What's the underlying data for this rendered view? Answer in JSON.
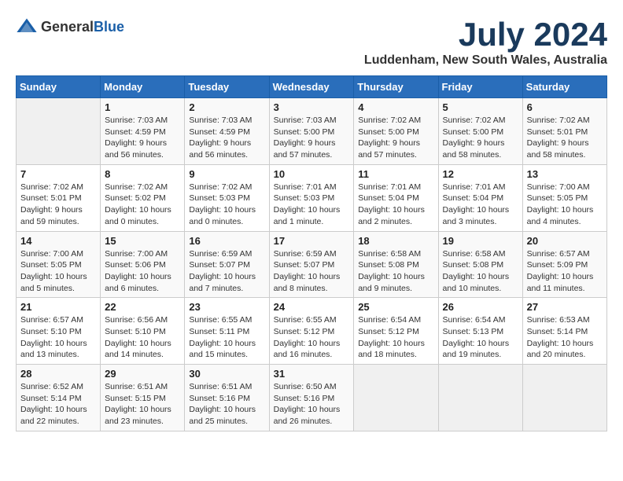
{
  "logo": {
    "general": "General",
    "blue": "Blue"
  },
  "title": {
    "month": "July 2024",
    "location": "Luddenham, New South Wales, Australia"
  },
  "days_of_week": [
    "Sunday",
    "Monday",
    "Tuesday",
    "Wednesday",
    "Thursday",
    "Friday",
    "Saturday"
  ],
  "weeks": [
    [
      {
        "day": "",
        "info": ""
      },
      {
        "day": "1",
        "info": "Sunrise: 7:03 AM\nSunset: 4:59 PM\nDaylight: 9 hours and 56 minutes."
      },
      {
        "day": "2",
        "info": "Sunrise: 7:03 AM\nSunset: 4:59 PM\nDaylight: 9 hours and 56 minutes."
      },
      {
        "day": "3",
        "info": "Sunrise: 7:03 AM\nSunset: 5:00 PM\nDaylight: 9 hours and 57 minutes."
      },
      {
        "day": "4",
        "info": "Sunrise: 7:02 AM\nSunset: 5:00 PM\nDaylight: 9 hours and 57 minutes."
      },
      {
        "day": "5",
        "info": "Sunrise: 7:02 AM\nSunset: 5:00 PM\nDaylight: 9 hours and 58 minutes."
      },
      {
        "day": "6",
        "info": "Sunrise: 7:02 AM\nSunset: 5:01 PM\nDaylight: 9 hours and 58 minutes."
      }
    ],
    [
      {
        "day": "7",
        "info": "Sunrise: 7:02 AM\nSunset: 5:01 PM\nDaylight: 9 hours and 59 minutes."
      },
      {
        "day": "8",
        "info": "Sunrise: 7:02 AM\nSunset: 5:02 PM\nDaylight: 10 hours and 0 minutes."
      },
      {
        "day": "9",
        "info": "Sunrise: 7:02 AM\nSunset: 5:03 PM\nDaylight: 10 hours and 0 minutes."
      },
      {
        "day": "10",
        "info": "Sunrise: 7:01 AM\nSunset: 5:03 PM\nDaylight: 10 hours and 1 minute."
      },
      {
        "day": "11",
        "info": "Sunrise: 7:01 AM\nSunset: 5:04 PM\nDaylight: 10 hours and 2 minutes."
      },
      {
        "day": "12",
        "info": "Sunrise: 7:01 AM\nSunset: 5:04 PM\nDaylight: 10 hours and 3 minutes."
      },
      {
        "day": "13",
        "info": "Sunrise: 7:00 AM\nSunset: 5:05 PM\nDaylight: 10 hours and 4 minutes."
      }
    ],
    [
      {
        "day": "14",
        "info": "Sunrise: 7:00 AM\nSunset: 5:05 PM\nDaylight: 10 hours and 5 minutes."
      },
      {
        "day": "15",
        "info": "Sunrise: 7:00 AM\nSunset: 5:06 PM\nDaylight: 10 hours and 6 minutes."
      },
      {
        "day": "16",
        "info": "Sunrise: 6:59 AM\nSunset: 5:07 PM\nDaylight: 10 hours and 7 minutes."
      },
      {
        "day": "17",
        "info": "Sunrise: 6:59 AM\nSunset: 5:07 PM\nDaylight: 10 hours and 8 minutes."
      },
      {
        "day": "18",
        "info": "Sunrise: 6:58 AM\nSunset: 5:08 PM\nDaylight: 10 hours and 9 minutes."
      },
      {
        "day": "19",
        "info": "Sunrise: 6:58 AM\nSunset: 5:08 PM\nDaylight: 10 hours and 10 minutes."
      },
      {
        "day": "20",
        "info": "Sunrise: 6:57 AM\nSunset: 5:09 PM\nDaylight: 10 hours and 11 minutes."
      }
    ],
    [
      {
        "day": "21",
        "info": "Sunrise: 6:57 AM\nSunset: 5:10 PM\nDaylight: 10 hours and 13 minutes."
      },
      {
        "day": "22",
        "info": "Sunrise: 6:56 AM\nSunset: 5:10 PM\nDaylight: 10 hours and 14 minutes."
      },
      {
        "day": "23",
        "info": "Sunrise: 6:55 AM\nSunset: 5:11 PM\nDaylight: 10 hours and 15 minutes."
      },
      {
        "day": "24",
        "info": "Sunrise: 6:55 AM\nSunset: 5:12 PM\nDaylight: 10 hours and 16 minutes."
      },
      {
        "day": "25",
        "info": "Sunrise: 6:54 AM\nSunset: 5:12 PM\nDaylight: 10 hours and 18 minutes."
      },
      {
        "day": "26",
        "info": "Sunrise: 6:54 AM\nSunset: 5:13 PM\nDaylight: 10 hours and 19 minutes."
      },
      {
        "day": "27",
        "info": "Sunrise: 6:53 AM\nSunset: 5:14 PM\nDaylight: 10 hours and 20 minutes."
      }
    ],
    [
      {
        "day": "28",
        "info": "Sunrise: 6:52 AM\nSunset: 5:14 PM\nDaylight: 10 hours and 22 minutes."
      },
      {
        "day": "29",
        "info": "Sunrise: 6:51 AM\nSunset: 5:15 PM\nDaylight: 10 hours and 23 minutes."
      },
      {
        "day": "30",
        "info": "Sunrise: 6:51 AM\nSunset: 5:16 PM\nDaylight: 10 hours and 25 minutes."
      },
      {
        "day": "31",
        "info": "Sunrise: 6:50 AM\nSunset: 5:16 PM\nDaylight: 10 hours and 26 minutes."
      },
      {
        "day": "",
        "info": ""
      },
      {
        "day": "",
        "info": ""
      },
      {
        "day": "",
        "info": ""
      }
    ]
  ]
}
